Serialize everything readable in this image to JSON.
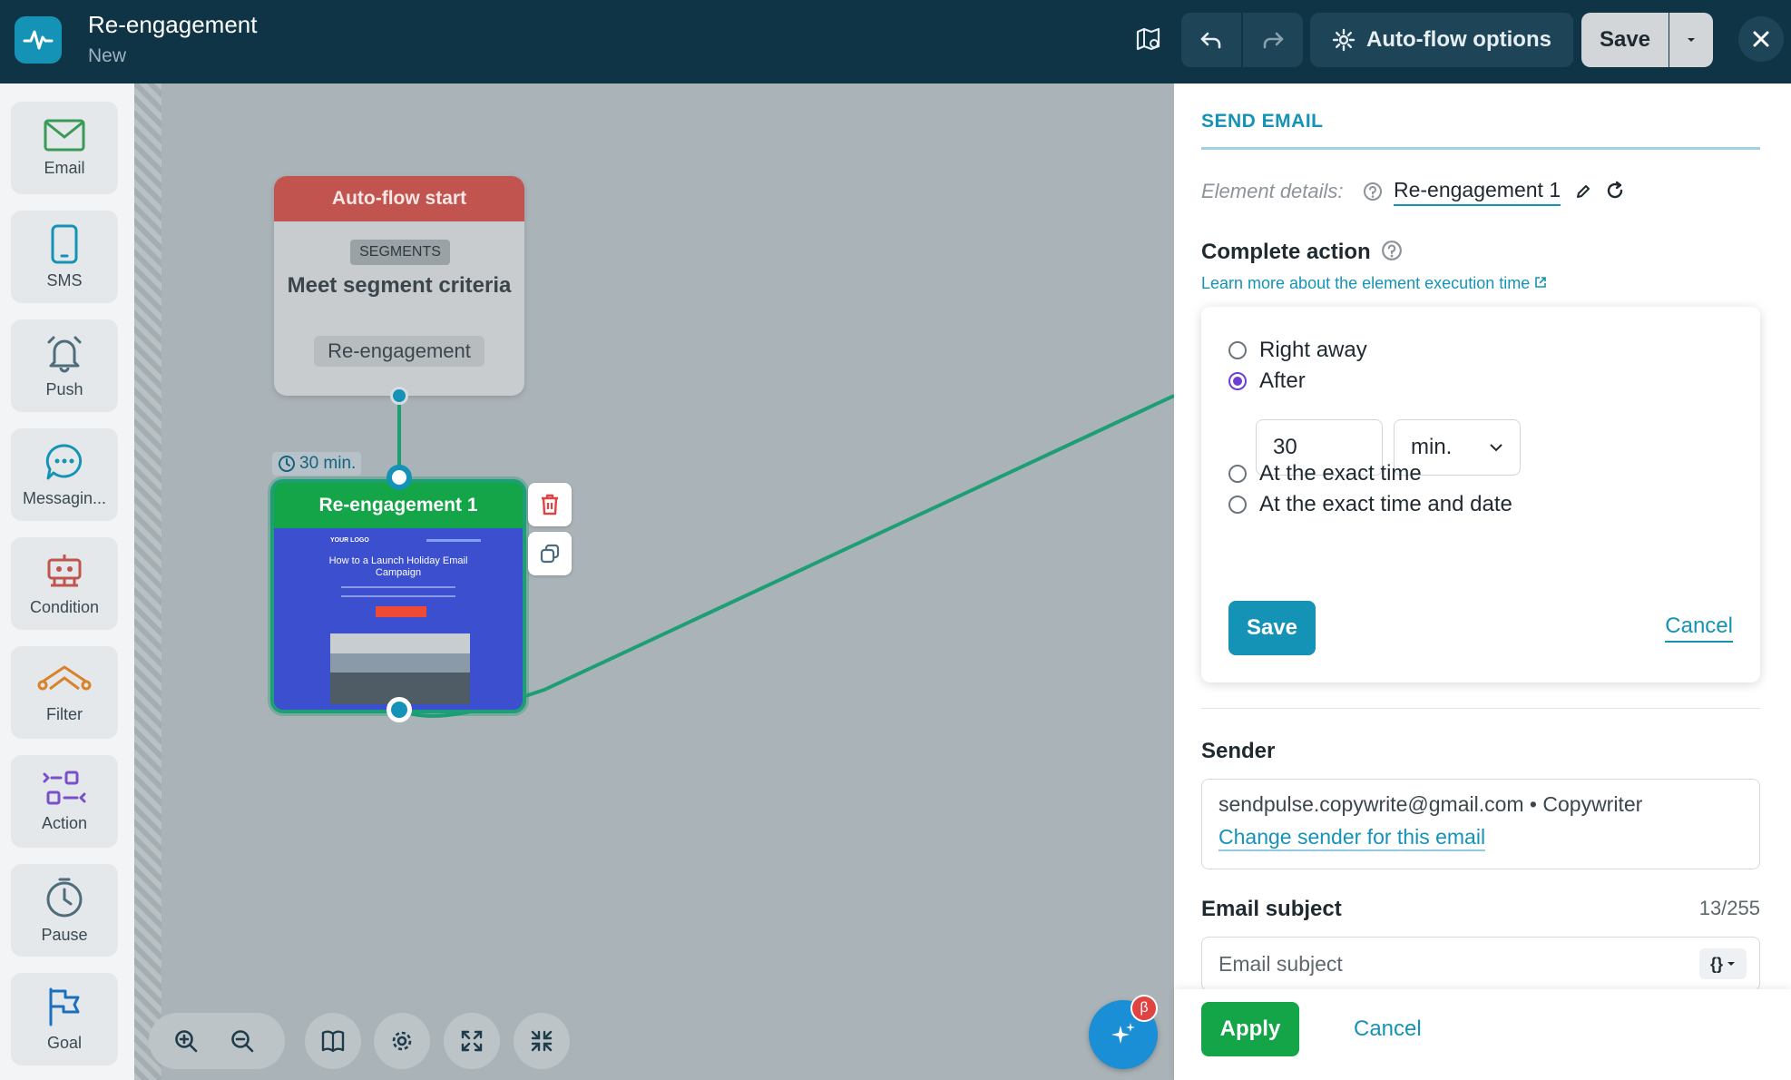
{
  "header": {
    "title": "Re-engagement",
    "subtitle": "New",
    "options_label": "Auto-flow options",
    "save_label": "Save"
  },
  "sidebar": {
    "items": [
      {
        "label": "Email",
        "icon": "envelope-icon"
      },
      {
        "label": "SMS",
        "icon": "phone-icon"
      },
      {
        "label": "Push",
        "icon": "bell-icon"
      },
      {
        "label": "Messagin...",
        "icon": "chat-icon"
      },
      {
        "label": "Condition",
        "icon": "robot-icon"
      },
      {
        "label": "Filter",
        "icon": "filter-icon"
      },
      {
        "label": "Action",
        "icon": "action-icon"
      },
      {
        "label": "Pause",
        "icon": "clock-icon"
      },
      {
        "label": "Goal",
        "icon": "flag-icon"
      }
    ]
  },
  "canvas": {
    "start_node": {
      "header": "Auto-flow start",
      "badge": "SEGMENTS",
      "title": "Meet segment criteria",
      "segment": "Re-engagement"
    },
    "timer": "30 min.",
    "email_node": {
      "title": "Re-engagement 1",
      "preview_logo": "YOUR LOGO",
      "preview_title": "How to a Launch Holiday Email Campaign"
    }
  },
  "panel": {
    "section_title": "SEND EMAIL",
    "element_details_label": "Element details:",
    "element_name": "Re-engagement 1",
    "complete_action_title": "Complete action",
    "learn_more_link": "Learn more about the element execution time",
    "options": [
      {
        "label": "Right away",
        "checked": false
      },
      {
        "label": "After",
        "checked": true
      },
      {
        "label": "At the exact time",
        "checked": false
      },
      {
        "label": "At the exact time and date",
        "checked": false
      }
    ],
    "delay_value": "30",
    "delay_unit": "min.",
    "card_save": "Save",
    "card_cancel": "Cancel",
    "sender_title": "Sender",
    "sender_value": "sendpulse.copywrite@gmail.com • Copywriter",
    "sender_link": "Change sender for this email",
    "subject_title": "Email subject",
    "subject_count": "13/255",
    "subject_placeholder": "Email subject",
    "apply_label": "Apply",
    "footer_cancel": "Cancel"
  },
  "ai_badge": "β",
  "colors": {
    "topbar": "#0e3446",
    "accent": "#1593b6",
    "start_header": "#c1544e",
    "email_header": "#14a548",
    "flow_line": "#1d9e74",
    "radio_checked": "#6d3fd0"
  }
}
